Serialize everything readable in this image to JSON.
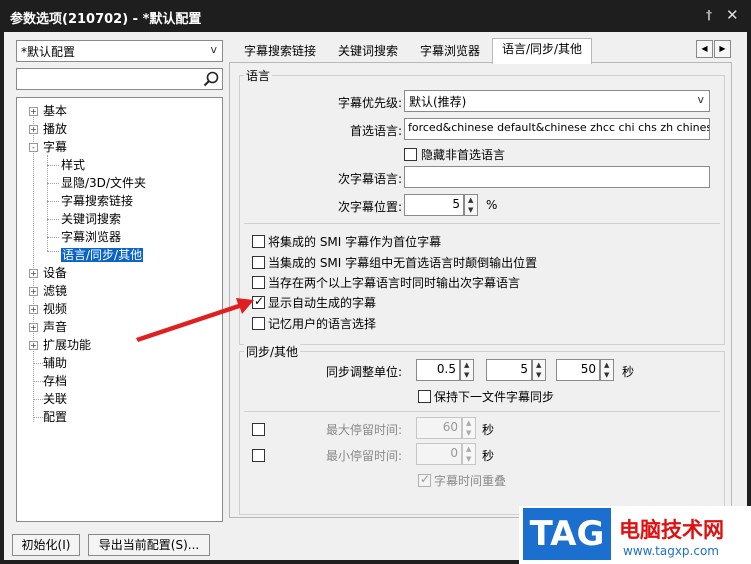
{
  "window": {
    "title": "参数选项(210702) - *默认配置",
    "pin_icon": "pin-icon",
    "close_icon": "close-icon"
  },
  "profile": {
    "selected": "*默认配置"
  },
  "search": {
    "value": "",
    "icon": "search-icon"
  },
  "tree": {
    "items": [
      {
        "label": "基本",
        "expander": "+"
      },
      {
        "label": "播放",
        "expander": "+"
      },
      {
        "label": "字幕",
        "expander": "-"
      },
      {
        "label": "样式"
      },
      {
        "label": "显隐/3D/文件夹"
      },
      {
        "label": "字幕搜索链接"
      },
      {
        "label": "关键词搜索"
      },
      {
        "label": "字幕浏览器"
      },
      {
        "label": "语言/同步/其他",
        "selected": true
      },
      {
        "label": "设备",
        "expander": "+"
      },
      {
        "label": "滤镜",
        "expander": "+"
      },
      {
        "label": "视频",
        "expander": "+"
      },
      {
        "label": "声音",
        "expander": "+"
      },
      {
        "label": "扩展功能",
        "expander": "+"
      },
      {
        "label": "辅助"
      },
      {
        "label": "存档"
      },
      {
        "label": "关联"
      },
      {
        "label": "配置"
      }
    ]
  },
  "tabs": [
    {
      "label": "字幕搜索链接"
    },
    {
      "label": "关键词搜索"
    },
    {
      "label": "字幕浏览器"
    },
    {
      "label": "语言/同步/其他",
      "active": true
    }
  ],
  "tab_scroll": {
    "left": "◀",
    "right": "▶"
  },
  "language": {
    "group_title": "语言",
    "priority_label": "字幕优先级:",
    "priority_value": "默认(推荐)",
    "preferred_label": "首选语言:",
    "preferred_value": "forced&chinese default&chinese zhcc chi chs zh chinese",
    "hide_non_preferred": {
      "label": "隐藏非首选语言",
      "checked": false
    },
    "secondary_label": "次字幕语言:",
    "secondary_value": "",
    "secondary_pos_label": "次字幕位置:",
    "secondary_pos_value": "5",
    "secondary_pos_unit": "%",
    "options": [
      {
        "label": "将集成的 SMI 字幕作为首位字幕",
        "checked": false
      },
      {
        "label": "当集成的 SMI 字幕组中无首选语言时颠倒输出位置",
        "checked": false
      },
      {
        "label": "当存在两个以上字幕语言时同时输出次字幕语言",
        "checked": false
      },
      {
        "label": "显示自动生成的字幕",
        "checked": true
      },
      {
        "label": "记忆用户的语言选择",
        "checked": false
      }
    ]
  },
  "sync": {
    "group_title": "同步/其他",
    "unit_label": "同步调整单位:",
    "unit_values": [
      "0.5",
      "5",
      "50"
    ],
    "unit_suffix": "秒",
    "keep_next": {
      "label": "保持下一文件字幕同步",
      "checked": false
    },
    "max_label": "最大停留时间:",
    "max_value": "60",
    "max_unit": "秒",
    "min_label": "最小停留时间:",
    "min_value": "0",
    "min_unit": "秒",
    "overlap": {
      "label": "字幕时间重叠",
      "checked": true
    }
  },
  "buttons": {
    "init": "初始化(I)",
    "export": "导出当前配置(S)..."
  },
  "watermark": {
    "tag": "TAG",
    "name": "电脑技术网",
    "url": "www.tagxp.com"
  },
  "colors": {
    "selection": "#0a64c8",
    "arrow": "#e02020",
    "tag_blue": "#1a6fcf",
    "tag_red": "#e01010"
  }
}
